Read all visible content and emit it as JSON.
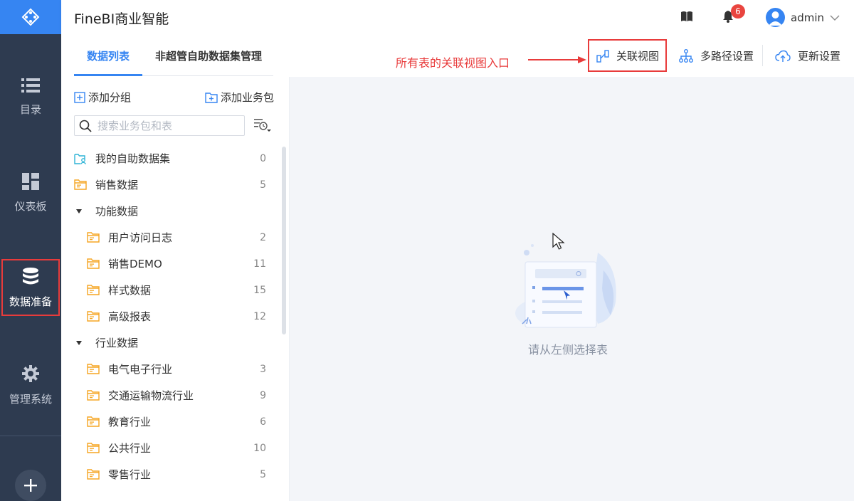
{
  "app": {
    "title": "FineBI商业智能"
  },
  "nav": {
    "items": [
      {
        "label": "目录",
        "icon": "list-icon"
      },
      {
        "label": "仪表板",
        "icon": "dashboard-icon"
      },
      {
        "label": "数据准备",
        "icon": "database-icon",
        "active": true
      },
      {
        "label": "管理系统",
        "icon": "gear-icon"
      }
    ],
    "add_icon": "plus-icon"
  },
  "header": {
    "notification_count": "6",
    "user_name": "admin"
  },
  "panel": {
    "tabs": [
      "数据列表",
      "非超管自助数据集管理"
    ],
    "add_group_label": "添加分组",
    "add_package_label": "添加业务包",
    "search_placeholder": "搜索业务包和表"
  },
  "tree": [
    {
      "label": "我的自助数据集",
      "count": "0",
      "type": "self-dataset"
    },
    {
      "label": "销售数据",
      "count": "5",
      "type": "folder"
    },
    {
      "label": "功能数据",
      "count": "",
      "type": "group"
    },
    {
      "label": "用户访问日志",
      "count": "2",
      "type": "folder"
    },
    {
      "label": "销售DEMO",
      "count": "11",
      "type": "folder"
    },
    {
      "label": "样式数据",
      "count": "15",
      "type": "folder"
    },
    {
      "label": "高级报表",
      "count": "12",
      "type": "folder"
    },
    {
      "label": "行业数据",
      "count": "",
      "type": "group"
    },
    {
      "label": "电气电子行业",
      "count": "3",
      "type": "folder"
    },
    {
      "label": "交通运输物流行业",
      "count": "9",
      "type": "folder"
    },
    {
      "label": "教育行业",
      "count": "6",
      "type": "folder"
    },
    {
      "label": "公共行业",
      "count": "10",
      "type": "folder"
    },
    {
      "label": "零售行业",
      "count": "5",
      "type": "folder"
    }
  ],
  "toolbar": {
    "annotation": "所有表的关联视图入口",
    "relation_view": "关联视图",
    "multipath": "多路径设置",
    "update": "更新设置"
  },
  "main": {
    "empty_text": "请从左侧选择表"
  },
  "colors": {
    "accent": "#3685f2",
    "nav_bg": "#2e3b50",
    "highlight": "#e83b3b",
    "folder": "#f5a623"
  }
}
